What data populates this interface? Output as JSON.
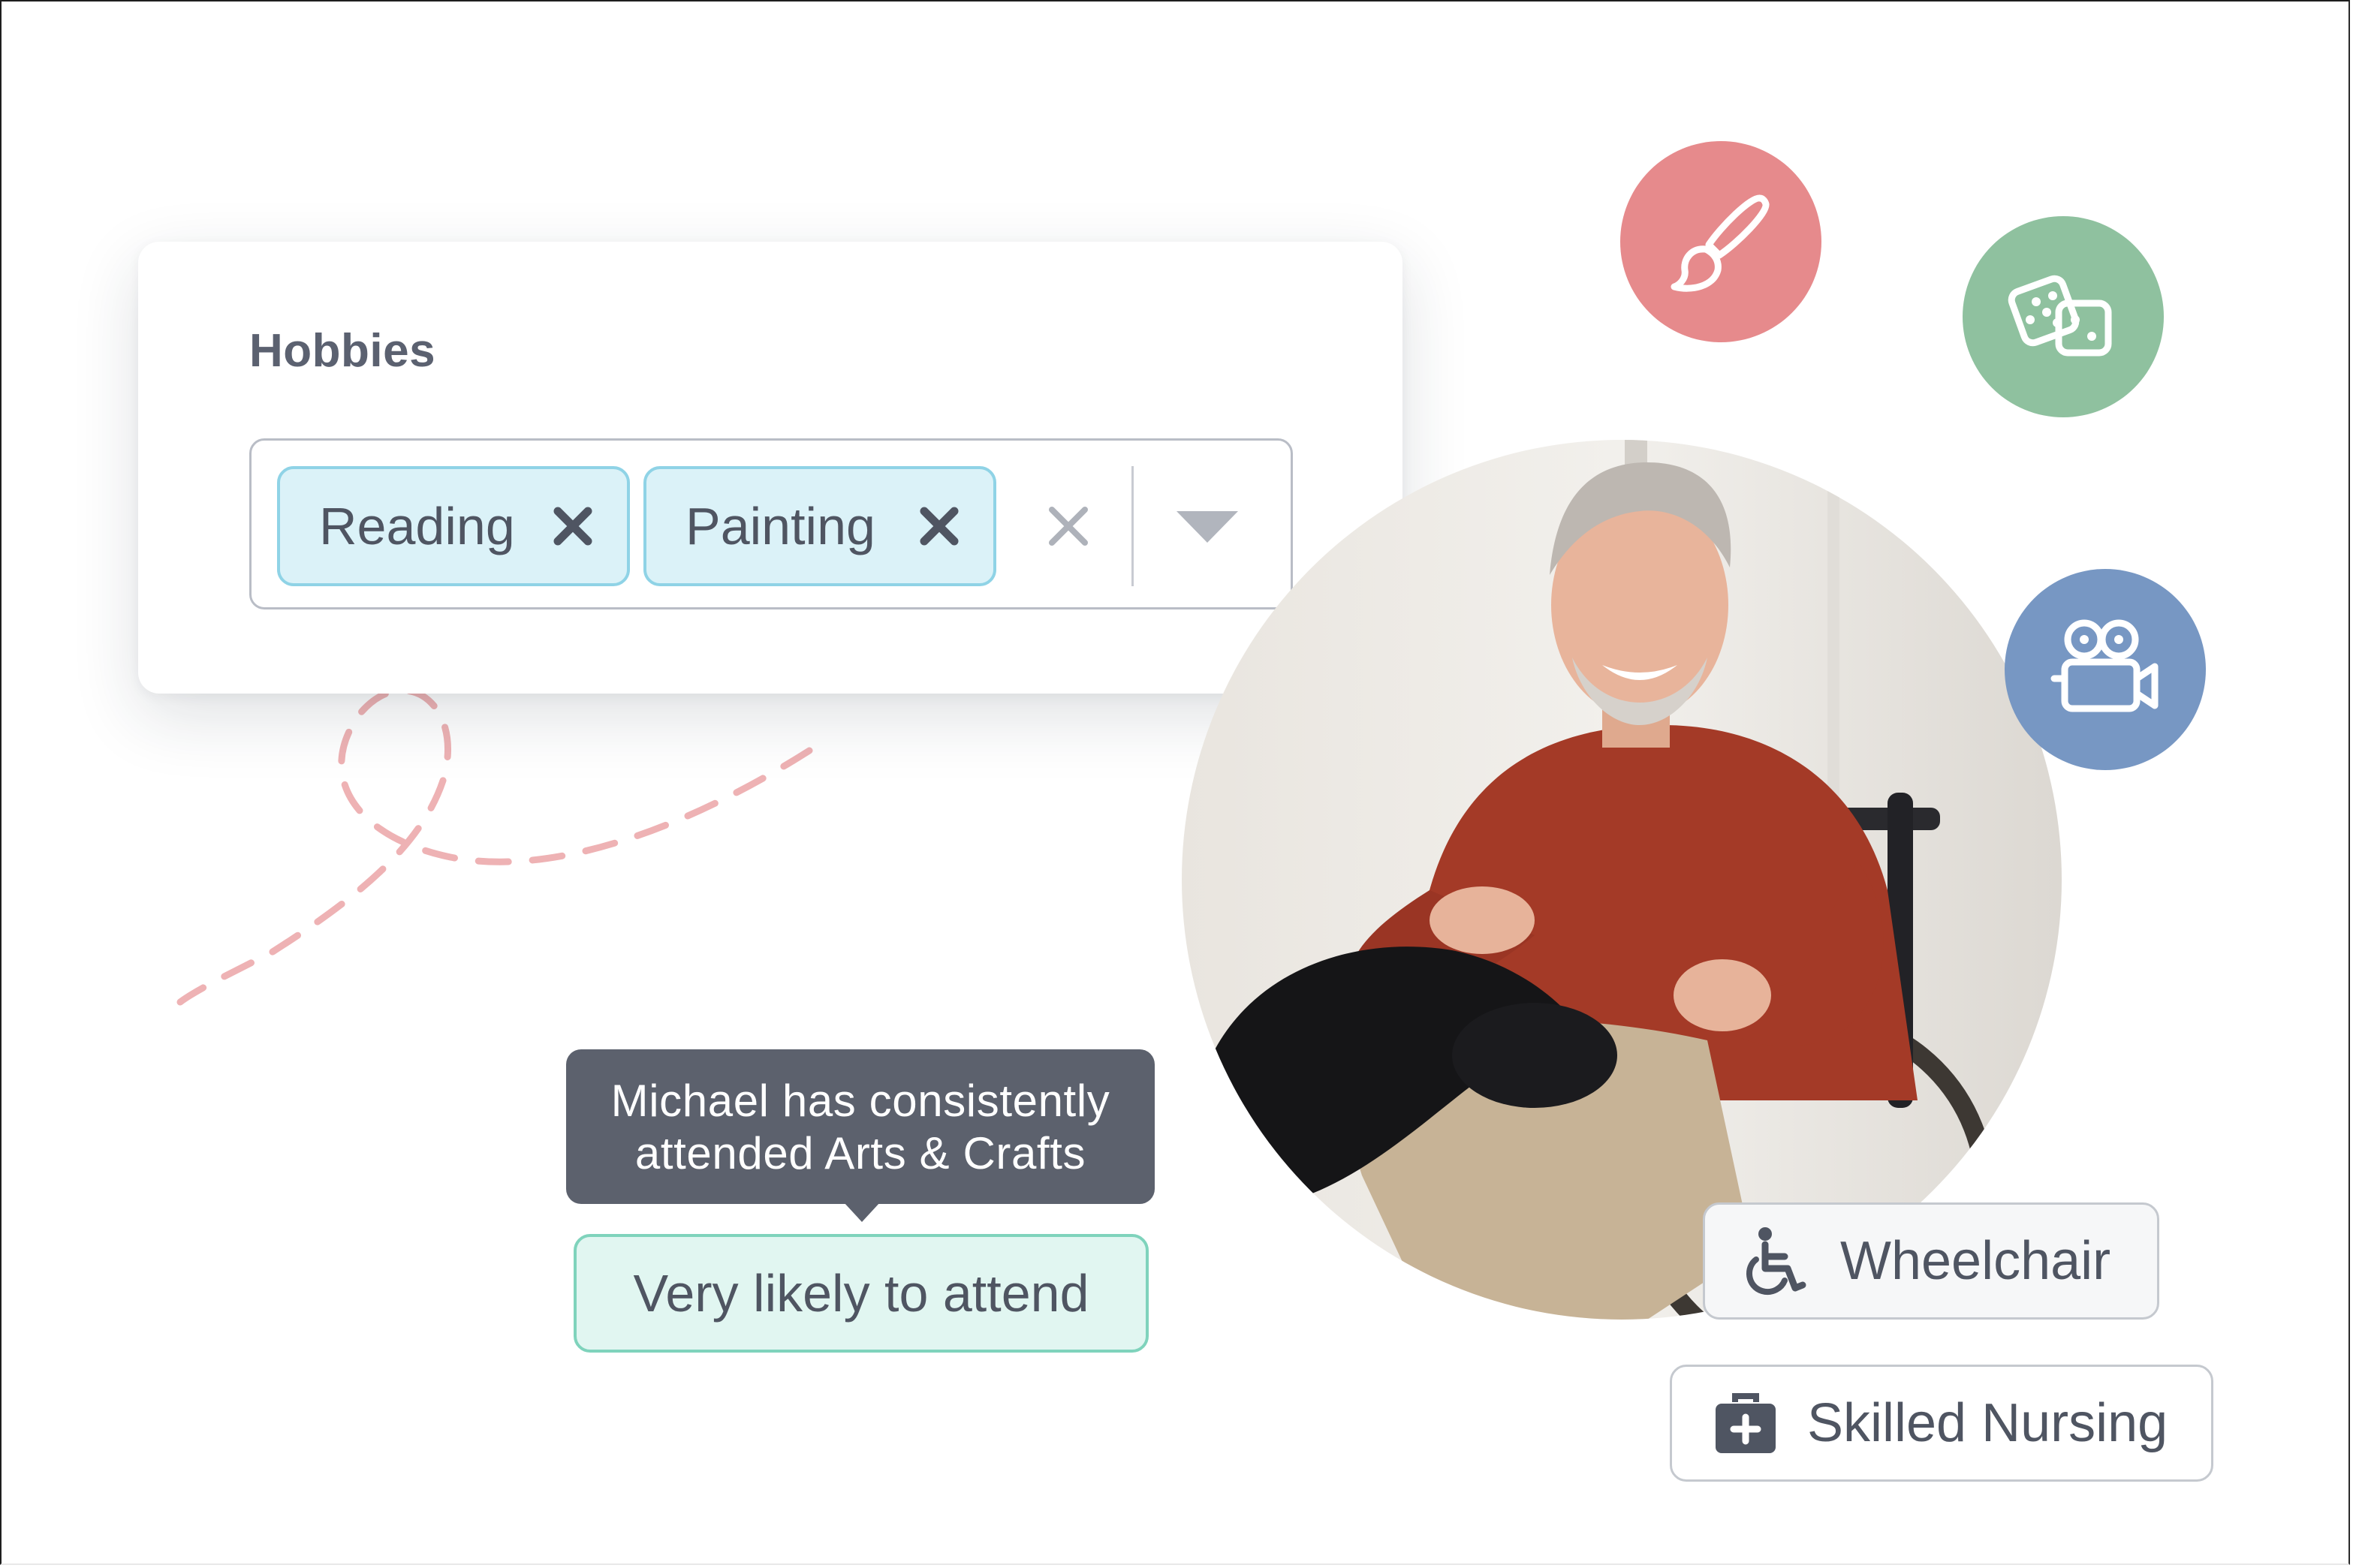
{
  "hobbies": {
    "title": "Hobbies",
    "chips": [
      {
        "label": "Reading"
      },
      {
        "label": "Painting"
      }
    ]
  },
  "tooltip": {
    "line1": "Michael has consistently",
    "line2": "attended Arts & Crafts"
  },
  "attendance": {
    "label": "Very likely to attend"
  },
  "badges": {
    "wheelchair": "Wheelchair",
    "skilled_nursing": "Skilled Nursing"
  },
  "icons": [
    "paintbrush-icon",
    "dice-icon",
    "film-camera-icon",
    "wheelchair-icon",
    "medical-kit-icon"
  ],
  "colors": {
    "chip_bg": "#dbf2f8",
    "chip_border": "#8fd3e6",
    "attend_bg": "#e1f6f1",
    "attend_border": "#7fd3bc",
    "tooltip_bg": "#5c616d",
    "paint_bubble": "#e68a8c",
    "dice_bubble": "#8fc19f",
    "camera_bubble": "#7797c3",
    "dash_line": "#eeb2b4"
  }
}
